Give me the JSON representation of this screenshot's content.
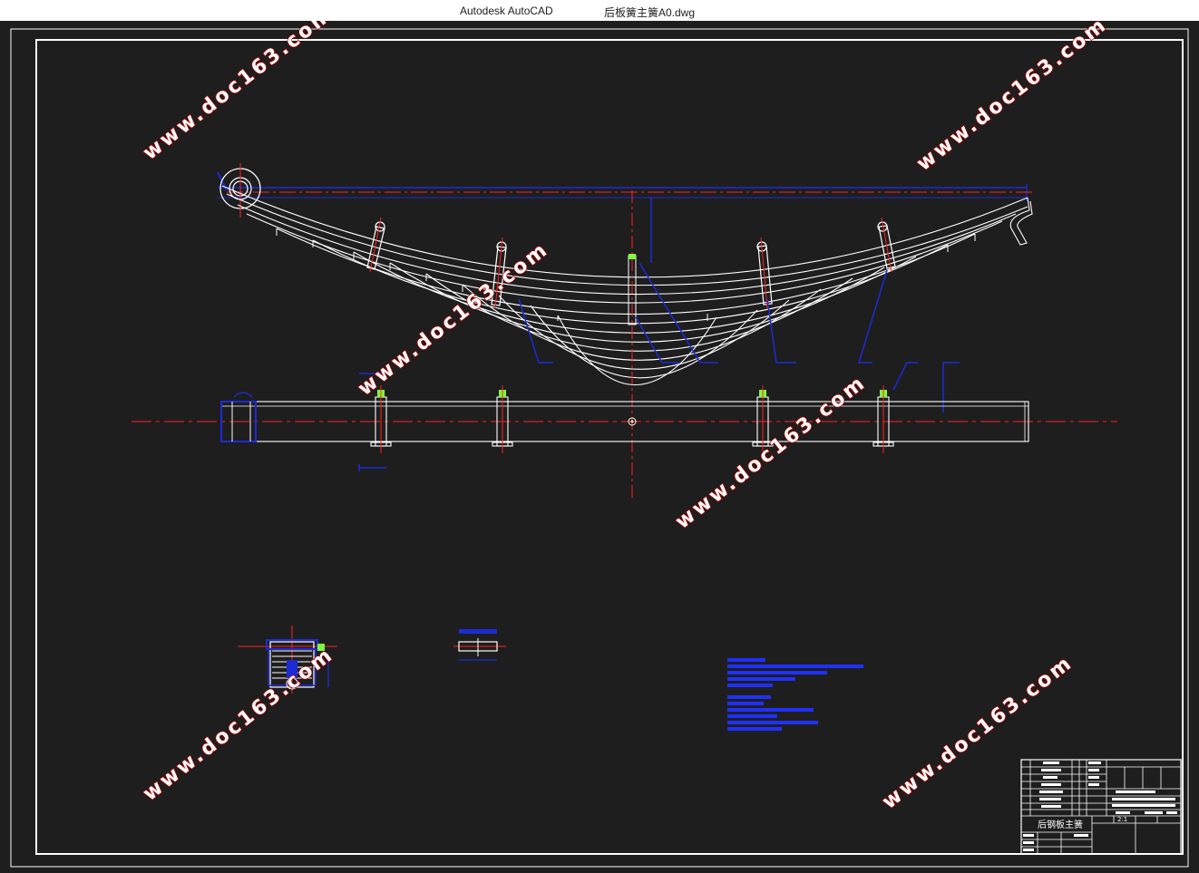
{
  "window": {
    "app_name": "Autodesk AutoCAD",
    "file_name": "后板簧主簧A0.dwg"
  },
  "title_block": {
    "part_title": "后钢板主簧",
    "scale": "2:1"
  },
  "watermarks": [
    "www.doc163.com",
    "www.doc163.com",
    "www.doc163.com",
    "www.doc163.com",
    "www.doc163.com",
    "www.doc163.com"
  ],
  "colors": {
    "background": "#1e1e1e",
    "geometry": "#ffffff",
    "centerline": "#ff2020",
    "dimension": "#1c2bd6",
    "annotation": "#2030ff",
    "highlight": "#7cff3c"
  }
}
